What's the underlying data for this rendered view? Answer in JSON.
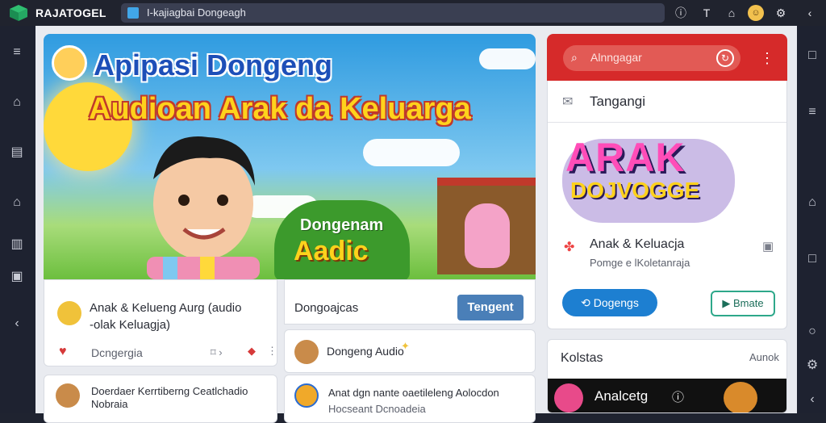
{
  "app": {
    "brand_name": "RAJATOGEL",
    "url_text": "I-kajiagbai Dongeagh"
  },
  "toolbar": {
    "icons": [
      "info-icon",
      "text-icon",
      "home-icon",
      "avatar",
      "settings-icon"
    ]
  },
  "hero": {
    "title_line1": "Apipasi Dongeng",
    "title_line2": "Audioan Arak da Keluarga",
    "badge_line1": "Dongenam",
    "badge_line2": "Aadic"
  },
  "cards": {
    "left_top": {
      "title_line1": "Anak & Kelueng Aurg (audio",
      "title_line2": "-olak Keluagja)",
      "meta": "Dcngergia"
    },
    "mid_top": {
      "heading": "Dongoajcas",
      "button": "Tengent",
      "item": "Dongeng Audio"
    },
    "left_bottom": {
      "line1": "Doerdaer Kerrtiberng Ceatlchadio",
      "line2": "Nobraia"
    },
    "mid_bottom": {
      "line1": "Anat dgn nante oaetileleng Aolocdon",
      "line2": "Hocseant Dcnoadeia"
    }
  },
  "right_panel": {
    "search_placeholder": "Alnngagar",
    "row_title": "Tangangi",
    "art_line1": "ARAK",
    "art_line2": "DOJVOGGE",
    "item_title": "Anak & Keluacja",
    "item_sub": "Pomge e lKoletanraja",
    "pill_button": "Dogengs",
    "outline_button": "Bmate",
    "section_title": "Kolstas",
    "section_link": "Aunok",
    "dark_label": "Analcetg"
  },
  "colors": {
    "accent_red": "#d62a2a",
    "primary_blue": "#4a7fb8",
    "pill_blue": "#1d7fd1",
    "teal": "#2ea88a"
  }
}
